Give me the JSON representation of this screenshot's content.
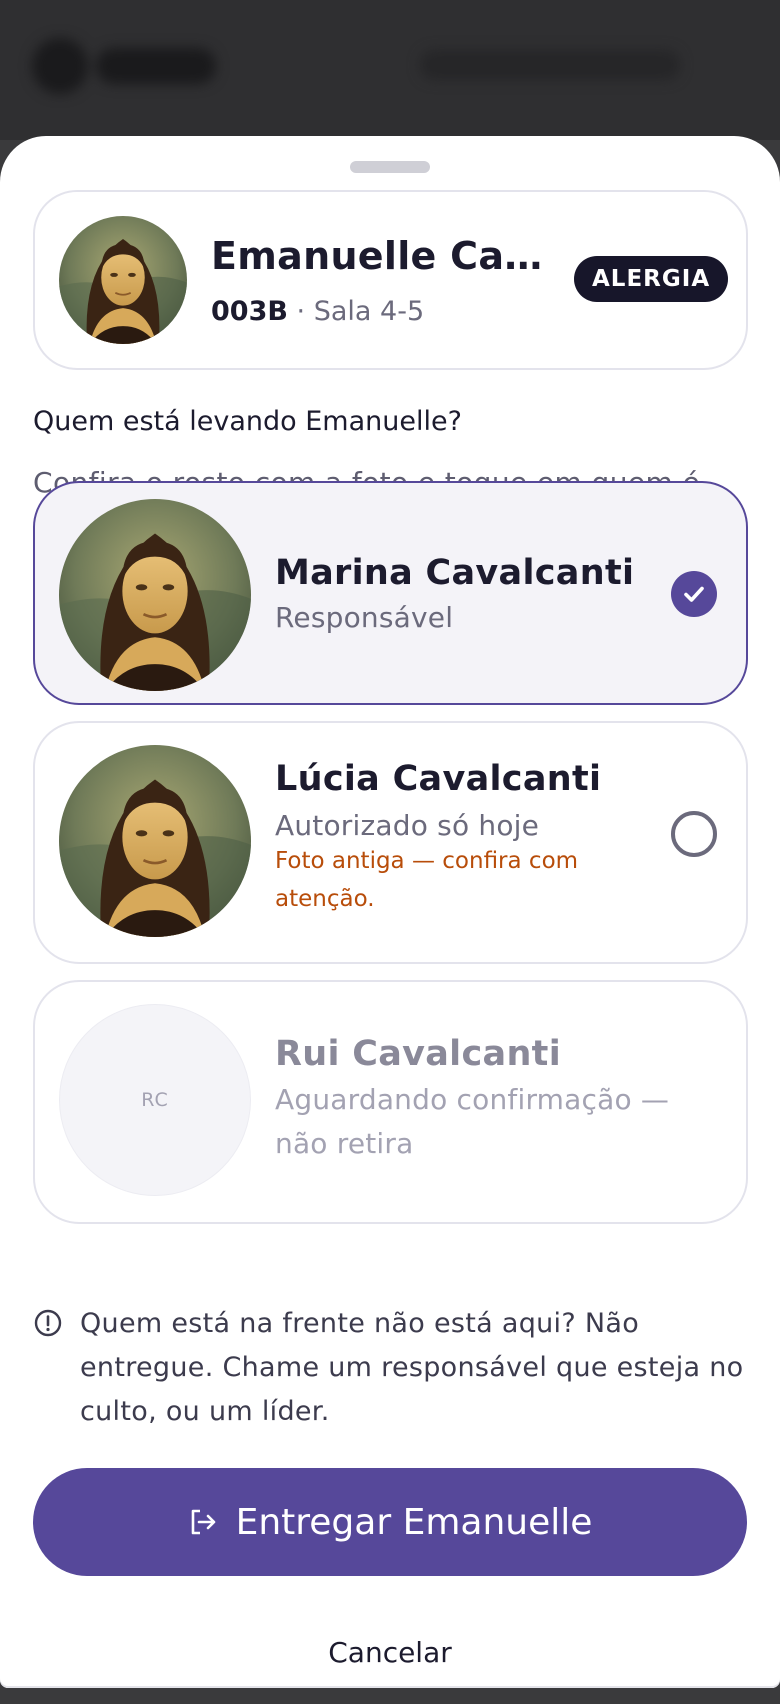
{
  "child": {
    "name": "Emanuelle Cav...",
    "code": "003B",
    "room": "· Sala 4-5",
    "badge": "ALERGIA"
  },
  "prompt": {
    "question": "Quem está levando Emanuelle?",
    "hint": "Confira o rosto com a foto e toque em quem é."
  },
  "people": [
    {
      "name": "Marina Cavalcanti",
      "role": "Responsável",
      "selected": true
    },
    {
      "name": "Lúcia Cavalcanti",
      "role": "Autorizado só hoje",
      "warning": "Foto antiga — confira com atenção.",
      "selected": false
    },
    {
      "name": "Rui Cavalcanti",
      "role": "Aguardando confirmação — não retira",
      "initials": "RC",
      "disabled": true
    }
  ],
  "notice": "Quem está na frente não está aqui? Não entregue. Chame um responsável que esteja no culto, ou um líder.",
  "actions": {
    "primary": "Entregar Emanuelle",
    "cancel": "Cancelar"
  },
  "colors": {
    "accent": "#56489a",
    "badge_bg": "#17162a",
    "warning": "#b84d0a"
  }
}
